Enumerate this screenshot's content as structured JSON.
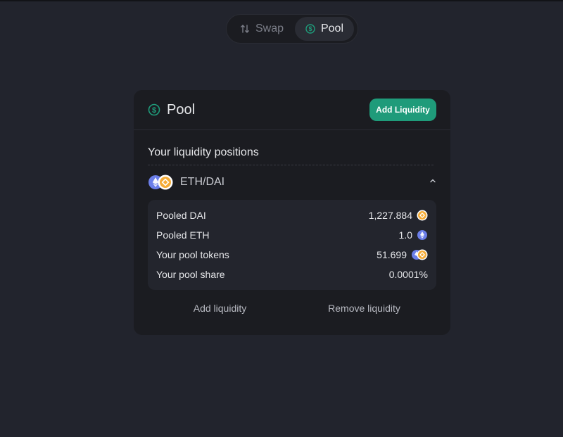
{
  "nav": {
    "swap_label": "Swap",
    "pool_label": "Pool",
    "active": "Pool"
  },
  "card": {
    "title": "Pool",
    "add_button_label": "Add Liquidity",
    "section_title": "Your liquidity positions",
    "position": {
      "pair": "ETH/DAI",
      "expanded": true,
      "rows": [
        {
          "label": "Pooled DAI",
          "value": "1,227.884",
          "icon": "dai-token-icon"
        },
        {
          "label": "Pooled ETH",
          "value": "1.0",
          "icon": "eth-token-icon"
        },
        {
          "label": "Your pool tokens",
          "value": "51.699",
          "icon": "eth-dai-pair-icon"
        },
        {
          "label": "Your pool share",
          "value": "0.0001%",
          "icon": ""
        }
      ],
      "add_action_label": "Add liquidity",
      "remove_action_label": "Remove liquidity"
    }
  },
  "colors": {
    "background": "#22242d",
    "card": "#1b1c21",
    "accent": "#1f9b7a",
    "eth": "#6b7ee8",
    "dai": "#f5ac37"
  }
}
